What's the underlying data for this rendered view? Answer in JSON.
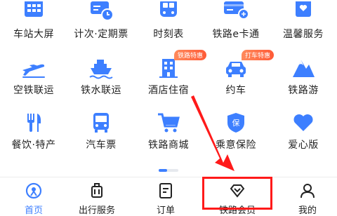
{
  "colors": {
    "accent": "#3d7fff",
    "badge": "#ff5a36",
    "annotation": "#ff1a1a"
  },
  "grid": {
    "rows": [
      [
        {
          "label": "车站大屏",
          "icon": "station-screen-icon"
        },
        {
          "label": "计次·定期票",
          "icon": "ticket-clock-icon"
        },
        {
          "label": "时刻表",
          "icon": "train-icon"
        },
        {
          "label": "铁路e卡通",
          "icon": "card-icon"
        },
        {
          "label": "温馨服务",
          "icon": "heart-bag-icon"
        }
      ],
      [
        {
          "label": "空铁联运",
          "icon": "plane-icon"
        },
        {
          "label": "铁水联运",
          "icon": "ship-icon"
        },
        {
          "label": "酒店住宿",
          "icon": "hotel-icon",
          "badge": "铁路特惠"
        },
        {
          "label": "约车",
          "icon": "car-icon",
          "badge": "打车特惠"
        },
        {
          "label": "铁路游",
          "icon": "mountain-icon"
        }
      ],
      [
        {
          "label": "餐饮·特产",
          "icon": "cutlery-icon"
        },
        {
          "label": "汽车票",
          "icon": "bus-icon"
        },
        {
          "label": "铁路商城",
          "icon": "cart-icon"
        },
        {
          "label": "乘意保险",
          "icon": "shield-icon"
        },
        {
          "label": "爱心版",
          "icon": "heart-icon"
        }
      ]
    ]
  },
  "tabbar": {
    "tabs": [
      {
        "label": "首页",
        "icon": "home-icon",
        "active": true
      },
      {
        "label": "出行服务",
        "icon": "luggage-icon"
      },
      {
        "label": "订单",
        "icon": "order-icon"
      },
      {
        "label": "铁路会员",
        "icon": "diamond-icon"
      },
      {
        "label": "我的",
        "icon": "user-icon"
      }
    ]
  }
}
